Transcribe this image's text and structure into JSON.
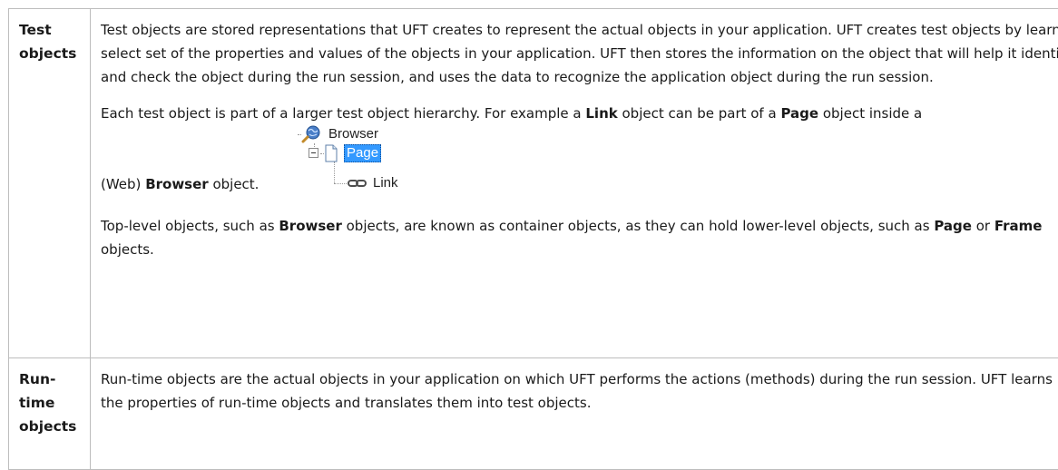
{
  "rows": [
    {
      "term": "Test objects",
      "paragraphs": {
        "p1": "Test objects are stored representations that UFT creates to represent the actual objects in your application. UFT creates test objects by learning a select set of the properties and values of the objects in your application. UFT then stores the information on the object that will help it identify and check the object during the run session, and uses the data to recognize the application object during the run session.",
        "p2_before": "Each test object is part of a larger test object hierarchy. For example a ",
        "p2_bold1": "Link",
        "p2_mid": " object can be part of a ",
        "p2_bold2": "Page",
        "p2_after": " object inside a",
        "p2_caption_before": "(Web) ",
        "p2_caption_bold": "Browser",
        "p2_caption_after": " object.",
        "p3_before": "Top-level objects, such as ",
        "p3_bold1": "Browser",
        "p3_mid1": " objects, are known as container objects, as they can hold lower-level objects, such as ",
        "p3_bold2": "Page",
        "p3_mid2": " or ",
        "p3_bold3": "Frame",
        "p3_after": " objects."
      },
      "hierarchy": {
        "root": "Browser",
        "child": "Page",
        "grandchild": "Link"
      }
    },
    {
      "term": "Run-time objects",
      "paragraphs": {
        "p1": "Run-time objects are the actual objects in your application on which UFT performs the actions (methods) during the run session. UFT learns the properties of run-time objects and translates them into test objects."
      }
    }
  ],
  "icons": {
    "browser": "browser-globe-icon",
    "page": "page-icon",
    "link": "link-chain-icon",
    "collapse": "collapse-minus-icon"
  },
  "colors": {
    "selection": "#3399ff",
    "border": "#bdbdbd"
  }
}
